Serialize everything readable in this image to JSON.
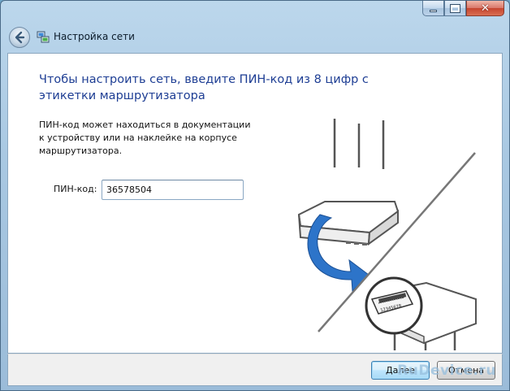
{
  "window": {
    "title": "Настройка сети"
  },
  "content": {
    "heading": "Чтобы настроить сеть, введите ПИН-код из 8 цифр с этикетки маршрутизатора",
    "description": "ПИН-код может находиться в документации к устройству или на наклейке на корпусе маршрутизатора.",
    "pin_label": "ПИН-код:",
    "pin_value": "36578504",
    "illustration_label_code": "12345678"
  },
  "footer": {
    "next_label": "Далее",
    "cancel_label": "Отмена"
  },
  "watermark": "RuDevice.ru",
  "colors": {
    "heading": "#1e3e94",
    "arrow": "#2d74c9",
    "router_outline": "#555555"
  },
  "icons": [
    "back-arrow-icon",
    "network-setup-icon",
    "minimize-icon",
    "maximize-icon",
    "close-icon",
    "router-illustration-icon"
  ]
}
